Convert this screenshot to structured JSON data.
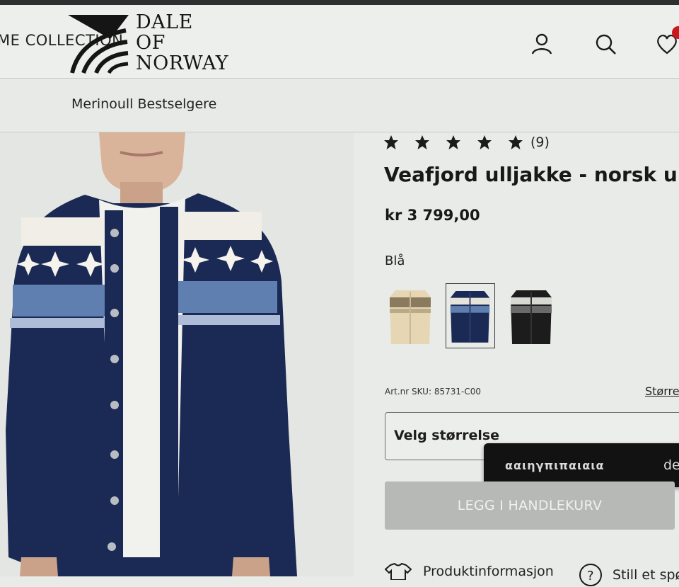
{
  "header": {
    "collection_label": "ME COLLECTION",
    "logo_lines": [
      "DALE",
      "OF",
      "NORWAY"
    ],
    "icons": [
      "account-icon",
      "search-icon",
      "wishlist-heart-icon"
    ],
    "badge_color": "#c8191e"
  },
  "subnav": {
    "item": "Merinoull Bestselgere"
  },
  "product": {
    "rating_stars": 5,
    "rating_count": "(9)",
    "title": "Veafjord ulljakke - norsk ull",
    "price": "kr 3 799,00",
    "color_label": "Blå",
    "swatches": [
      {
        "name": "cream",
        "selected": false
      },
      {
        "name": "navy",
        "selected": true
      },
      {
        "name": "black",
        "selected": false
      }
    ],
    "sku": "Art.nr SKU: 85731-C00",
    "size_guide": "Størrel",
    "size_select": "Velg størrelse",
    "add_to_cart": "LEGG I HANDLEKURV"
  },
  "toast": {
    "text": "ααιηγπιπαιαια",
    "tail": "de"
  },
  "tabs": [
    {
      "icon": "shirt-icon",
      "label": "Produktinformasjon"
    },
    {
      "icon": "question-icon",
      "label": "Still et spø"
    }
  ],
  "colors": {
    "navy": "#1b2a55",
    "accent_blue": "#5f7fb0"
  }
}
